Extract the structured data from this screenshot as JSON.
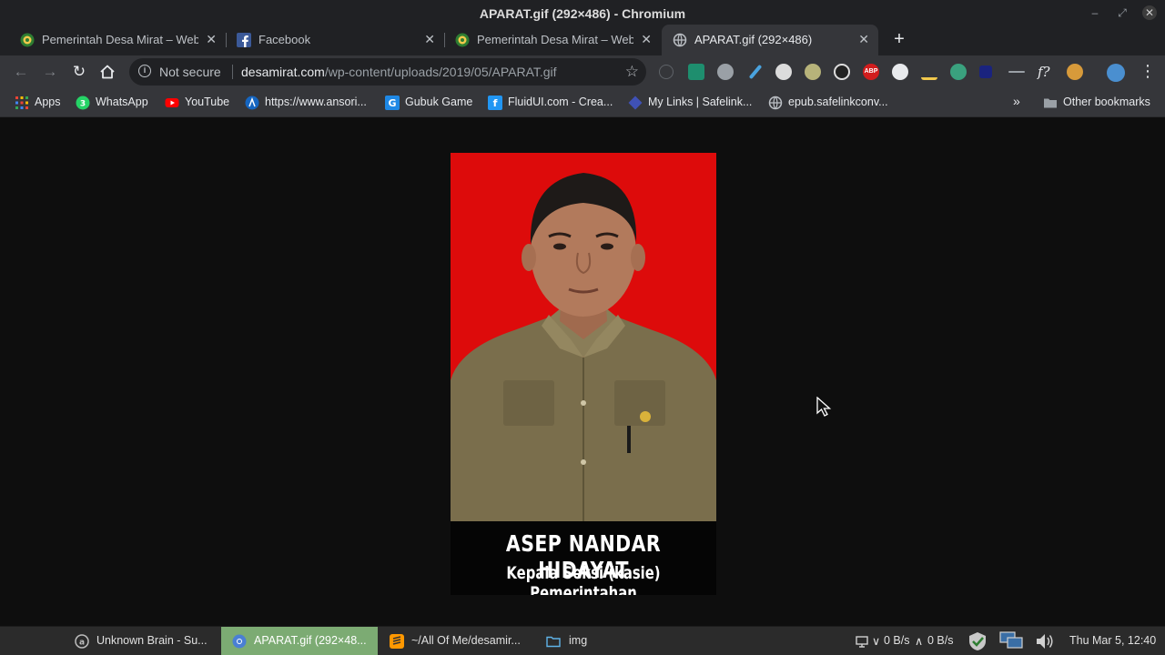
{
  "window": {
    "title": "APARAT.gif (292×486) - Chromium"
  },
  "tabs": [
    {
      "label": "Pemerintah Desa Mirat – Webs",
      "icon": "garuda-icon"
    },
    {
      "label": "Facebook",
      "icon": "facebook-icon"
    },
    {
      "label": "Pemerintah Desa Mirat – Webs",
      "icon": "garuda-icon"
    },
    {
      "label": "APARAT.gif (292×486)",
      "icon": "globe-icon",
      "active": true
    }
  ],
  "omnibox": {
    "security_label": "Not secure",
    "url_host": "desamirat.com",
    "url_path": "/wp-content/uploads/2019/05/APARAT.gif"
  },
  "bookmarks": [
    {
      "label": "Apps",
      "icon": "apps-grid-icon"
    },
    {
      "label": "WhatsApp",
      "icon": "whatsapp-icon"
    },
    {
      "label": "YouTube",
      "icon": "youtube-icon"
    },
    {
      "label": "https://www.ansori...",
      "icon": "ansori-icon"
    },
    {
      "label": "Gubuk Game",
      "icon": "gubuk-game-icon"
    },
    {
      "label": "FluidUI.com - Crea...",
      "icon": "fluidui-icon"
    },
    {
      "label": "My Links | Safelink...",
      "icon": "safelink-icon"
    },
    {
      "label": "epub.safelinkconv...",
      "icon": "globe-icon"
    }
  ],
  "other_bookmarks": "Other bookmarks",
  "image": {
    "name": "ASEP NANDAR HIDAYAT",
    "role": "Kepala Seksi (kasie) Pemerintahan"
  },
  "taskbar": {
    "tasks": [
      {
        "label": "Unknown Brain - Su...",
        "icon": "audacious-icon"
      },
      {
        "label": "APARAT.gif (292×48...",
        "icon": "chromium-icon",
        "active": true
      },
      {
        "label": "~/All Of Me/desamir...",
        "icon": "sublime-icon"
      },
      {
        "label": "img",
        "icon": "folder-icon"
      }
    ],
    "net_down": "0 B/s",
    "net_up": "0 B/s",
    "clock": "Thu Mar  5, 12:40"
  },
  "colors": {
    "photo_background": "#dd0b0b",
    "active_task": "#7cab73"
  }
}
